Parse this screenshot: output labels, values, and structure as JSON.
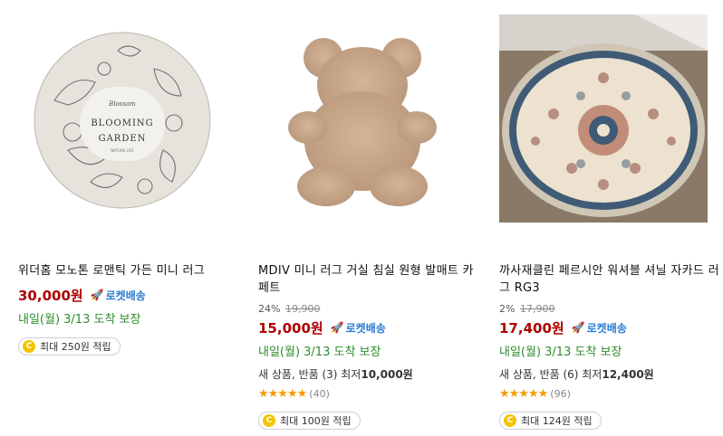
{
  "products": [
    {
      "name": "위더홈 모노톤 로맨틱 가든 미니 러그",
      "price": "30,000원",
      "rocket_label": "로켓배송",
      "arrival": "내일(월) 3/13 도착 보장",
      "reward": "최대 250원 적립",
      "image_text": {
        "script": "Blossom",
        "line1": "BLOOMING",
        "line2": "GARDEN",
        "sub": "NATURE LIFE"
      }
    },
    {
      "name": "MDIV 미니 러그 거실 침실 원형 발매트 카페트",
      "discount_rate": "24%",
      "original_price": "19,900",
      "price": "15,000원",
      "rocket_label": "로켓배송",
      "arrival": "내일(월) 3/13 도착 보장",
      "used_prefix": "새 상품, 반품 (3) 최저",
      "used_price": "10,000원",
      "stars": "★★★★★",
      "review_count": "(40)",
      "reward": "최대 100원 적립"
    },
    {
      "name": "까사재클린 페르시안 워셔블 셔닐 자카드 러그 RG3",
      "discount_rate": "2%",
      "original_price": "17,900",
      "price": "17,400원",
      "rocket_label": "로켓배송",
      "arrival": "내일(월) 3/13 도착 보장",
      "used_prefix": "새 상품, 반품 (6) 최저",
      "used_price": "12,400원",
      "stars": "★★★★★",
      "review_count": "(96)",
      "reward": "최대 124원 적립"
    }
  ],
  "icons": {
    "rocket": "rocket-icon",
    "coin": "coin-icon",
    "star": "star-icon"
  },
  "colors": {
    "price": "#ae0000",
    "rocket": "#2b7cd3",
    "arrival": "#2e8c2e",
    "star": "#f59b00",
    "coin": "#f5c400"
  }
}
